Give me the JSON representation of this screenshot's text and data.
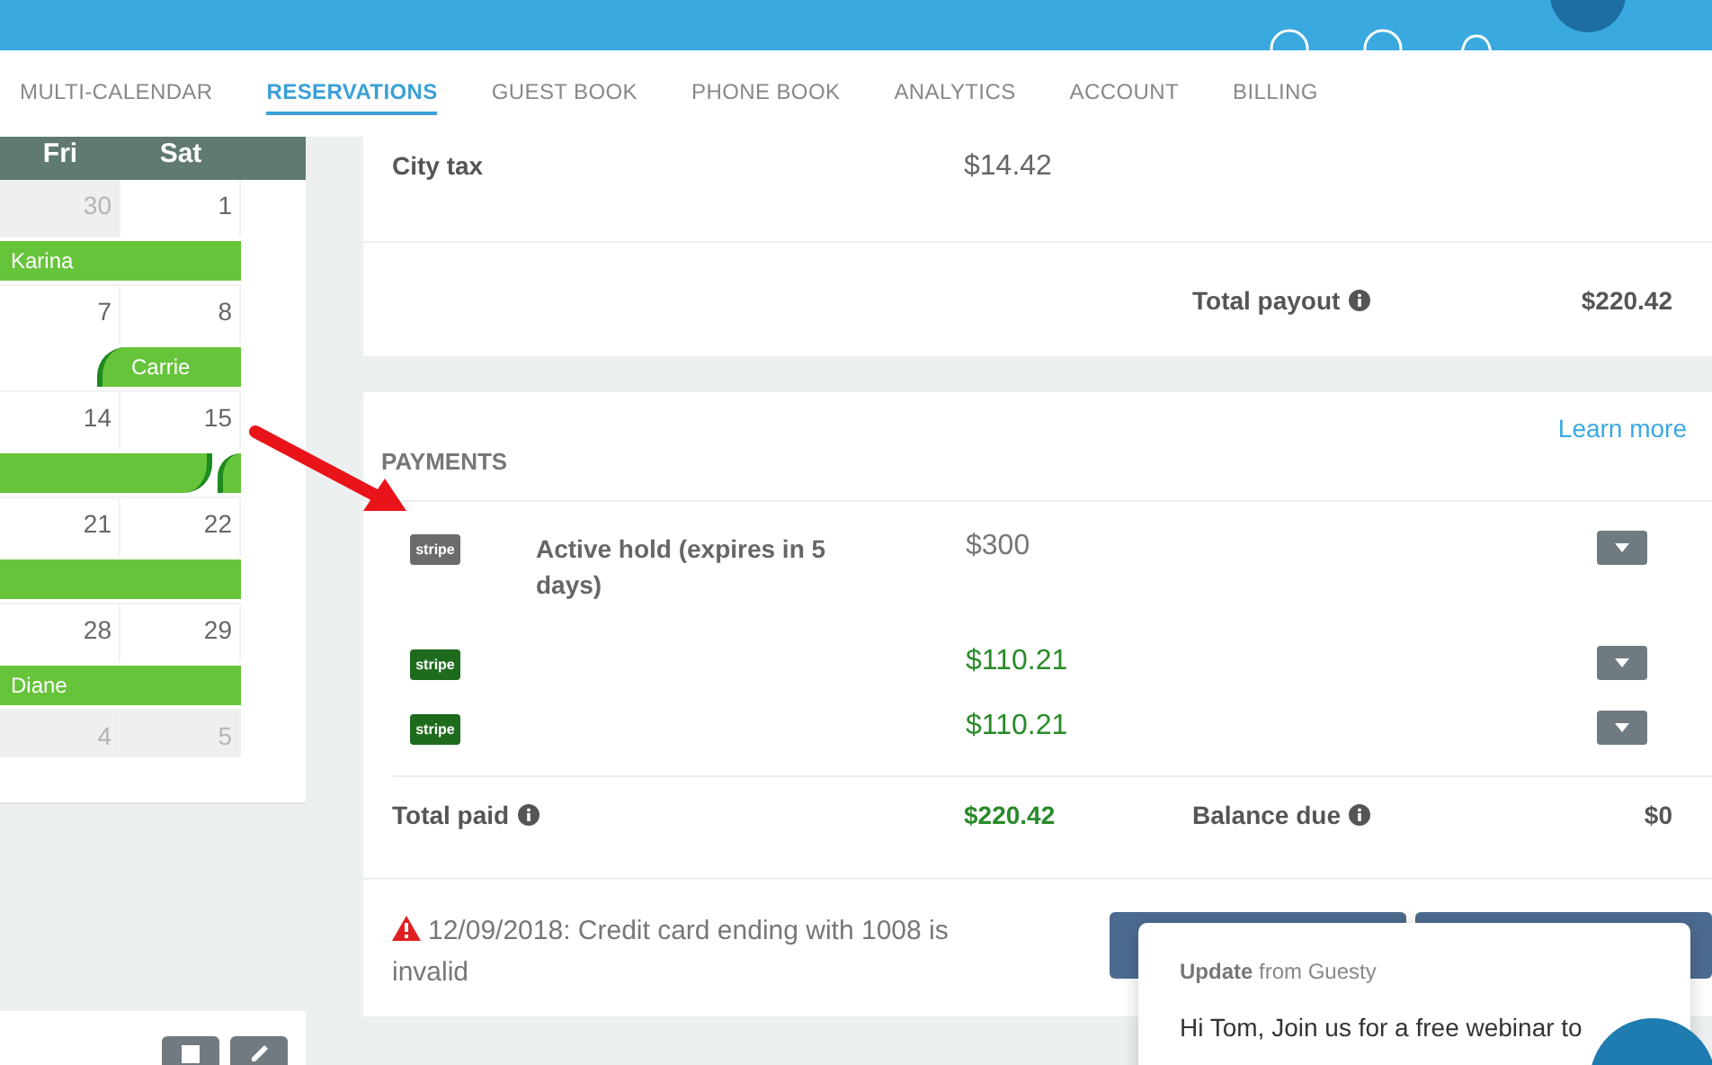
{
  "nav": {
    "tabs": [
      {
        "label": "MULTI-CALENDAR",
        "selected": false
      },
      {
        "label": "RESERVATIONS",
        "selected": true
      },
      {
        "label": "GUEST BOOK",
        "selected": false
      },
      {
        "label": "PHONE BOOK",
        "selected": false
      },
      {
        "label": "ANALYTICS",
        "selected": false
      },
      {
        "label": "ACCOUNT",
        "selected": false
      },
      {
        "label": "BILLING",
        "selected": false
      }
    ]
  },
  "calendar": {
    "days": [
      "Fri",
      "Sat"
    ],
    "weeks": [
      {
        "cells": [
          {
            "day": "30",
            "outside": true
          },
          {
            "day": "1",
            "outside": false
          }
        ],
        "bookings": [
          {
            "kind": "span",
            "guest": "Karina"
          }
        ]
      },
      {
        "cells": [
          {
            "day": "7",
            "outside": false
          },
          {
            "day": "8",
            "outside": false
          }
        ],
        "bookings": [
          {
            "kind": "checkin",
            "guest": "Carrie"
          }
        ]
      },
      {
        "cells": [
          {
            "day": "14",
            "outside": false
          },
          {
            "day": "15",
            "outside": false
          }
        ],
        "bookings": [
          {
            "kind": "checkout"
          },
          {
            "kind": "checkin-late"
          }
        ]
      },
      {
        "cells": [
          {
            "day": "21",
            "outside": false
          },
          {
            "day": "22",
            "outside": false
          }
        ],
        "bookings": [
          {
            "kind": "span"
          }
        ]
      },
      {
        "cells": [
          {
            "day": "28",
            "outside": false
          },
          {
            "day": "29",
            "outside": false
          }
        ],
        "bookings": [
          {
            "kind": "span",
            "guest": "Diane"
          }
        ]
      },
      {
        "cells": [
          {
            "day": "4",
            "outside": true
          },
          {
            "day": "5",
            "outside": true
          }
        ]
      }
    ]
  },
  "summary": {
    "fees": [
      {
        "label": "City tax",
        "amount": "$14.42"
      }
    ],
    "total_payout": {
      "label": "Total payout",
      "value": "$220.42"
    }
  },
  "payments": {
    "title": "PAYMENTS",
    "link": "Learn more",
    "items": [
      {
        "logo": "stripe",
        "kind": "hold",
        "description": "Active hold (expires in 5 days)",
        "amount": "$300"
      },
      {
        "logo": "stripe",
        "kind": "paid",
        "amount": "$110.21"
      },
      {
        "logo": "stripe",
        "kind": "paid",
        "amount": "$110.21"
      }
    ],
    "total_paid": {
      "label": "Total paid",
      "value": "$220.42"
    },
    "balance_due": {
      "label": "Balance due",
      "value": "$0"
    }
  },
  "alert": {
    "text": "12/09/2018: Credit card ending with 1008 is invalid"
  },
  "popup": {
    "title": "Update",
    "source": "from Guesty",
    "message": "Hi Tom, Join us for a free webinar to"
  }
}
